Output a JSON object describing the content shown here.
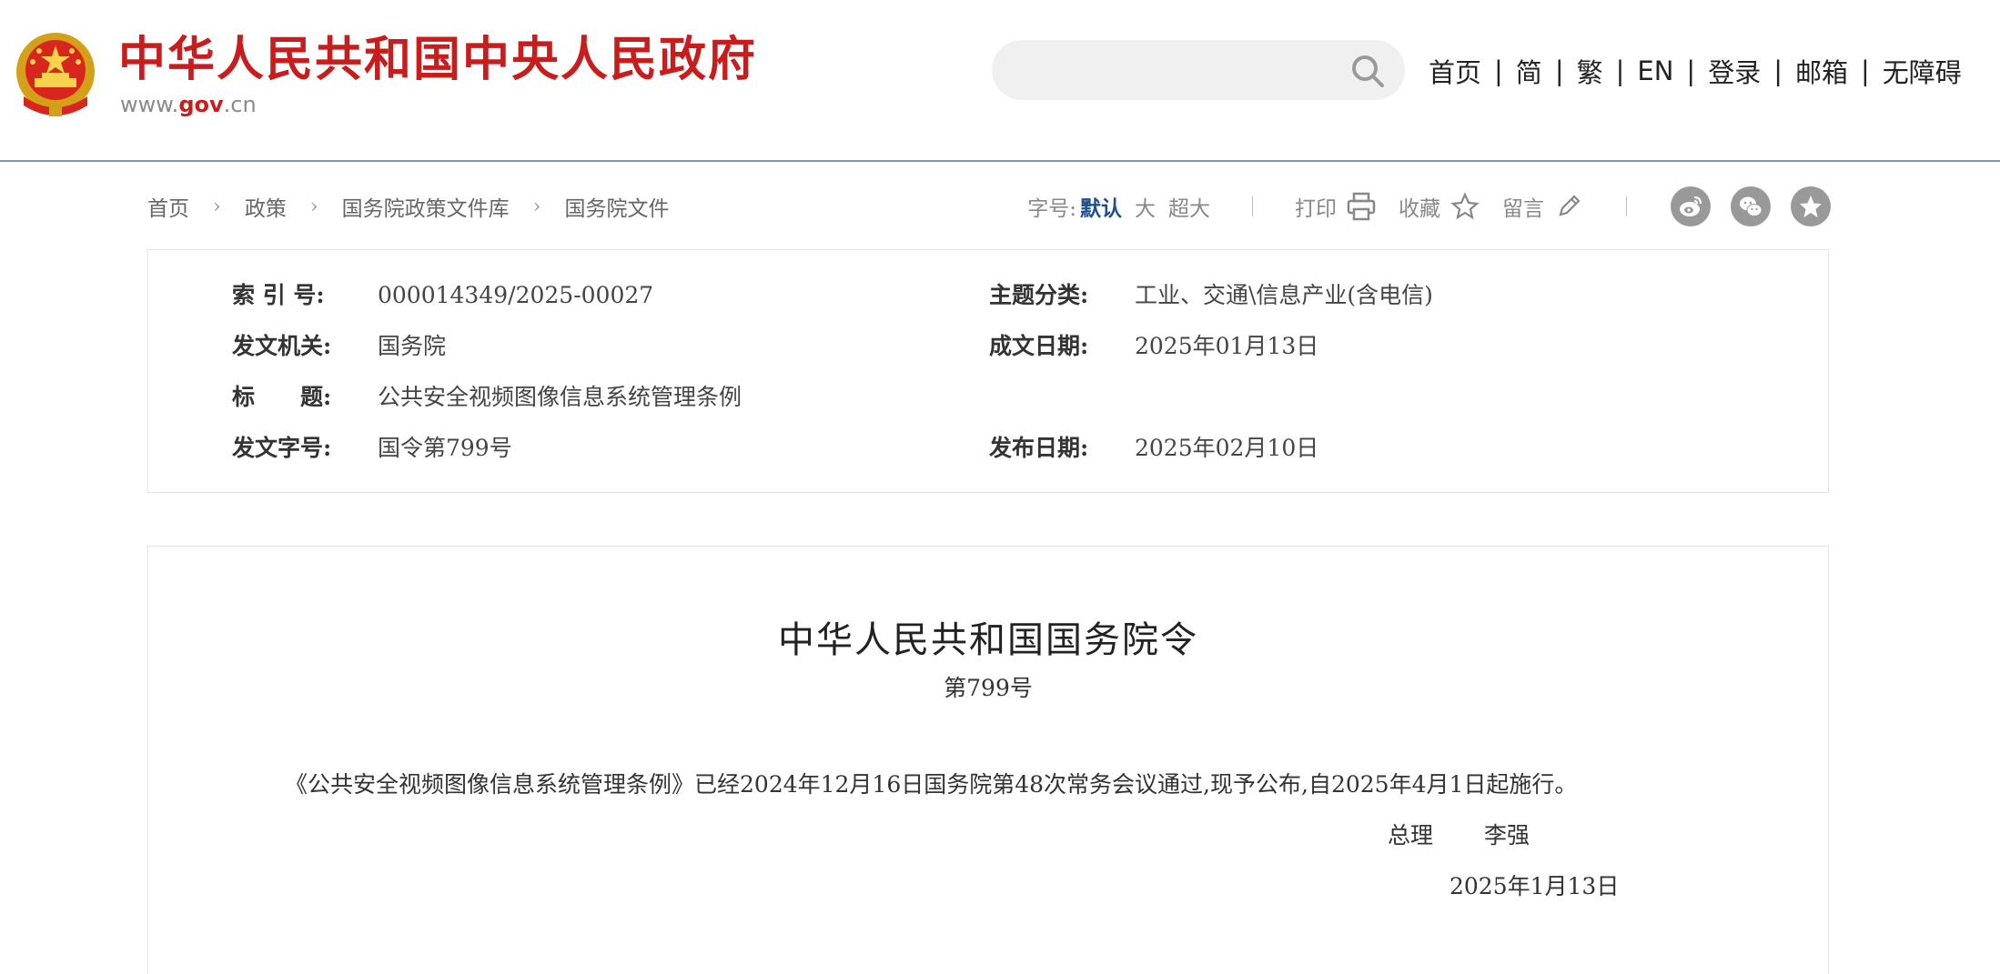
{
  "header": {
    "site_title": "中华人民共和国中央人民政府",
    "domain_prefix": "www.",
    "domain_main": "gov",
    "domain_suffix": ".cn",
    "search_placeholder": "",
    "nav": [
      "首页",
      "简",
      "繁",
      "EN",
      "登录",
      "邮箱",
      "无障碍"
    ],
    "nav_separator": "|",
    "brand_color": "#c91d1d"
  },
  "breadcrumb": [
    "首页",
    "政策",
    "国务院政策文件库",
    "国务院文件"
  ],
  "tools": {
    "font_size_label": "字号:",
    "font_size_default": "默认",
    "font_size_large": "大",
    "font_size_xlarge": "超大",
    "print_label": "打印",
    "favorite_label": "收藏",
    "comment_label": "留言",
    "share_icons": [
      "weibo-icon",
      "wechat-icon",
      "star-icon"
    ]
  },
  "info": {
    "index_label": "索 引 号:",
    "index_value": "000014349/2025-00027",
    "topic_label": "主题分类:",
    "topic_value": "工业、交通\\信息产业(含电信)",
    "issuer_label": "发文机关:",
    "issuer_value": "国务院",
    "written_date_label": "成文日期:",
    "written_date_value": "2025年01月13日",
    "title_label": "标　　题:",
    "title_value": "公共安全视频图像信息系统管理条例",
    "doc_number_label": "发文字号:",
    "doc_number_value": "国令第799号",
    "publish_date_label": "发布日期:",
    "publish_date_value": "2025年02月10日"
  },
  "document": {
    "title": "中华人民共和国国务院令",
    "number": "第799号",
    "body": "《公共安全视频图像信息系统管理条例》已经2024年12月16日国务院第48次常务会议通过,现予公布,自2025年4月1日起施行。",
    "signer_title": "总理",
    "signer_name": "李强",
    "date": "2025年1月13日"
  }
}
